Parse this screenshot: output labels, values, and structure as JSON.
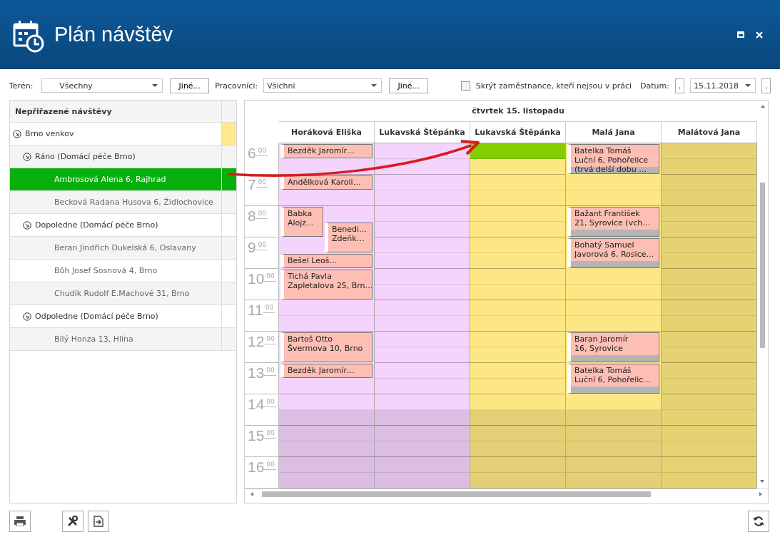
{
  "window": {
    "title": "Plán návštěv"
  },
  "filters": {
    "terrain": {
      "label": "Terén:",
      "value": "Všechny",
      "button": "Jiné..."
    },
    "workers": {
      "label": "Pracovníci:",
      "value": "Všichni",
      "button": "Jiné..."
    },
    "hide_absent": {
      "label": "Skrýt zaměstnance, kteří nejsou v práci",
      "checked": false
    },
    "date": {
      "label": "Datum:",
      "prev": ".",
      "value": "15.11.2018",
      "next": "."
    }
  },
  "unassigned": {
    "title": "Nepřiřazené návštěvy",
    "items": [
      {
        "label": "Brno venkov",
        "expanded": true,
        "selected": false,
        "color": "#ffe98a",
        "children": [
          {
            "label": "Ráno (Domácí péče Brno)",
            "expanded": true,
            "selected": false,
            "children": [
              {
                "label": "Ambrosová Alena 6, Rajhrad",
                "selected": true
              },
              {
                "label": "Becková Radana Husova 6, Židlochovice",
                "selected": false
              }
            ]
          },
          {
            "label": "Dopoledne (Domácí péče Brno)",
            "expanded": true,
            "selected": false,
            "children": [
              {
                "label": "Beran Jindřich Dukelská 6, Oslavany",
                "selected": false
              },
              {
                "label": "Bůh Josef Sosnová 4, Brno",
                "selected": false
              },
              {
                "label": "Chudík Rudolf E.Machové 31, Brno",
                "selected": false
              }
            ]
          },
          {
            "label": "Odpoledne (Domácí péče Brno)",
            "expanded": true,
            "selected": false,
            "children": [
              {
                "label": "Bílý Honza 13, Hlína",
                "selected": false
              }
            ]
          }
        ]
      }
    ]
  },
  "schedule": {
    "day": "čtvrtek 15. listopadu",
    "hours": [
      {
        "hour": "6",
        "minutes": "00"
      },
      {
        "hour": "7",
        "minutes": "00"
      },
      {
        "hour": "8",
        "minutes": "00"
      },
      {
        "hour": "9",
        "minutes": "00"
      },
      {
        "hour": "10",
        "minutes": "00"
      },
      {
        "hour": "11",
        "minutes": "00"
      },
      {
        "hour": "12",
        "minutes": "00"
      },
      {
        "hour": "13",
        "minutes": "00"
      },
      {
        "hour": "14",
        "minutes": "00"
      },
      {
        "hour": "15",
        "minutes": "00"
      },
      {
        "hour": "16",
        "minutes": "00"
      }
    ],
    "columns": [
      {
        "name": "Horáková Eliška",
        "color": "#f4d4fc",
        "slots": [
          {
            "kind": "event",
            "lines": [
              "Bezděk Jaromír…"
            ],
            "spans_hour": false,
            "shaded": false
          },
          {
            "kind": "free",
            "working": true,
            "highlighted": false
          },
          {
            "kind": "event",
            "lines": [
              "Andělková Karoli…"
            ],
            "spans_hour": false,
            "shaded": false
          },
          {
            "kind": "free",
            "working": true,
            "highlighted": false
          },
          {
            "kind": "pair",
            "events": [
              {
                "lines": [
                  "Babka",
                  "Alojz…"
                ],
                "shaded": false
              },
              {
                "lines": [
                  "Benedi…",
                  "Zdeňk…"
                ],
                "shaded": false
              }
            ]
          },
          {
            "kind": "event",
            "lines": [
              "Bešel Leoš…"
            ],
            "spans_hour": false,
            "shaded": false
          },
          {
            "kind": "event",
            "lines": [
              "Tichá Pavla",
              "Zapletalova 25, Brn…"
            ],
            "spans_hour": true,
            "shaded": false
          },
          {
            "kind": "free",
            "working": true,
            "highlighted": false
          },
          {
            "kind": "free",
            "working": true,
            "highlighted": false
          },
          {
            "kind": "event",
            "lines": [
              "Bartoš Otto",
              "Švermova 10, Brno"
            ],
            "spans_hour": true,
            "shaded": false
          },
          {
            "kind": "event",
            "lines": [
              "Bezděk Jaromír…"
            ],
            "spans_hour": false,
            "shaded": false
          },
          {
            "kind": "free",
            "working": true,
            "highlighted": false
          },
          {
            "kind": "free",
            "working": true,
            "highlighted": false
          },
          {
            "kind": "free",
            "working": false,
            "highlighted": false
          },
          {
            "kind": "free",
            "working": false,
            "highlighted": false
          },
          {
            "kind": "free",
            "working": false,
            "highlighted": false
          },
          {
            "kind": "free",
            "working": false,
            "highlighted": false
          },
          {
            "kind": "free",
            "working": false,
            "highlighted": false
          }
        ]
      },
      {
        "name": "Lukavská Štěpánka",
        "color": "#f4d4fc",
        "slots": [
          {
            "kind": "free",
            "working": true,
            "highlighted": false
          },
          {
            "kind": "free",
            "working": true,
            "highlighted": false
          },
          {
            "kind": "free",
            "working": true,
            "highlighted": false
          },
          {
            "kind": "free",
            "working": true,
            "highlighted": false
          },
          {
            "kind": "free",
            "working": true,
            "highlighted": false
          },
          {
            "kind": "free",
            "working": true,
            "highlighted": false
          },
          {
            "kind": "free",
            "working": true,
            "highlighted": false
          },
          {
            "kind": "free",
            "working": true,
            "highlighted": false
          },
          {
            "kind": "free",
            "working": true,
            "highlighted": false
          },
          {
            "kind": "free",
            "working": true,
            "highlighted": false
          },
          {
            "kind": "free",
            "working": true,
            "highlighted": false
          },
          {
            "kind": "free",
            "working": true,
            "highlighted": false
          },
          {
            "kind": "free",
            "working": true,
            "highlighted": false
          },
          {
            "kind": "free",
            "working": true,
            "highlighted": false
          },
          {
            "kind": "free",
            "working": true,
            "highlighted": false
          },
          {
            "kind": "free",
            "working": true,
            "highlighted": false
          },
          {
            "kind": "free",
            "working": true,
            "highlighted": false
          },
          {
            "kind": "free",
            "working": false,
            "highlighted": false
          },
          {
            "kind": "free",
            "working": false,
            "highlighted": false
          },
          {
            "kind": "free",
            "working": false,
            "highlighted": false
          },
          {
            "kind": "free",
            "working": false,
            "highlighted": false
          },
          {
            "kind": "free",
            "working": false,
            "highlighted": false
          }
        ]
      },
      {
        "name": "Lukavská Štěpánka",
        "color": "#fde784",
        "slots": [
          {
            "kind": "free",
            "working": true,
            "highlighted": true
          },
          {
            "kind": "free",
            "working": true,
            "highlighted": false
          },
          {
            "kind": "free",
            "working": true,
            "highlighted": false
          },
          {
            "kind": "free",
            "working": true,
            "highlighted": false
          },
          {
            "kind": "free",
            "working": true,
            "highlighted": false
          },
          {
            "kind": "free",
            "working": true,
            "highlighted": false
          },
          {
            "kind": "free",
            "working": true,
            "highlighted": false
          },
          {
            "kind": "free",
            "working": true,
            "highlighted": false
          },
          {
            "kind": "free",
            "working": true,
            "highlighted": false
          },
          {
            "kind": "free",
            "working": true,
            "highlighted": false
          },
          {
            "kind": "free",
            "working": true,
            "highlighted": false
          },
          {
            "kind": "free",
            "working": true,
            "highlighted": false
          },
          {
            "kind": "free",
            "working": true,
            "highlighted": false
          },
          {
            "kind": "free",
            "working": true,
            "highlighted": false
          },
          {
            "kind": "free",
            "working": true,
            "highlighted": false
          },
          {
            "kind": "free",
            "working": true,
            "highlighted": false
          },
          {
            "kind": "free",
            "working": true,
            "highlighted": false
          },
          {
            "kind": "free",
            "working": false,
            "highlighted": false
          },
          {
            "kind": "free",
            "working": false,
            "highlighted": false
          },
          {
            "kind": "free",
            "working": false,
            "highlighted": false
          },
          {
            "kind": "free",
            "working": false,
            "highlighted": false
          },
          {
            "kind": "free",
            "working": false,
            "highlighted": false
          }
        ]
      },
      {
        "name": "Malá Jana",
        "color": "#fde784",
        "slots": [
          {
            "kind": "event",
            "lines": [
              "Batelka Tomáš",
              "Luční 6, Pohořelice",
              "(trvá delší dobu …"
            ],
            "spans_hour": true,
            "shaded": true
          },
          {
            "kind": "free",
            "working": true,
            "highlighted": false
          },
          {
            "kind": "free",
            "working": true,
            "highlighted": false
          },
          {
            "kind": "event",
            "lines": [
              "Bažant František",
              "21, Syrovice (vch…"
            ],
            "spans_hour": true,
            "shaded": true
          },
          {
            "kind": "event",
            "lines": [
              "Bohatý Samuel",
              "Javorová 6, Rosice…"
            ],
            "spans_hour": true,
            "shaded": true
          },
          {
            "kind": "free",
            "working": true,
            "highlighted": false
          },
          {
            "kind": "free",
            "working": true,
            "highlighted": false
          },
          {
            "kind": "free",
            "working": true,
            "highlighted": false
          },
          {
            "kind": "free",
            "working": true,
            "highlighted": false
          },
          {
            "kind": "event",
            "lines": [
              "Baran Jaromír",
              "16, Syrovice"
            ],
            "spans_hour": true,
            "shaded": true
          },
          {
            "kind": "event",
            "lines": [
              "Batelka Tomáš",
              "Luční 6, Pohořelic…"
            ],
            "spans_hour": true,
            "shaded": true
          },
          {
            "kind": "free",
            "working": true,
            "highlighted": false
          },
          {
            "kind": "free",
            "working": false,
            "highlighted": false
          },
          {
            "kind": "free",
            "working": false,
            "highlighted": false
          },
          {
            "kind": "free",
            "working": false,
            "highlighted": false
          },
          {
            "kind": "free",
            "working": false,
            "highlighted": false
          },
          {
            "kind": "free",
            "working": false,
            "highlighted": false
          }
        ]
      },
      {
        "name": "Malátová Jana",
        "color": "#e5d373",
        "slots": [
          {
            "kind": "free",
            "working": true,
            "highlighted": false
          },
          {
            "kind": "free",
            "working": true,
            "highlighted": false
          },
          {
            "kind": "free",
            "working": true,
            "highlighted": false
          },
          {
            "kind": "free",
            "working": true,
            "highlighted": false
          },
          {
            "kind": "free",
            "working": true,
            "highlighted": false
          },
          {
            "kind": "free",
            "working": true,
            "highlighted": false
          },
          {
            "kind": "free",
            "working": true,
            "highlighted": false
          },
          {
            "kind": "free",
            "working": true,
            "highlighted": false
          },
          {
            "kind": "free",
            "working": true,
            "highlighted": false
          },
          {
            "kind": "free",
            "working": true,
            "highlighted": false
          },
          {
            "kind": "free",
            "working": true,
            "highlighted": false
          },
          {
            "kind": "free",
            "working": true,
            "highlighted": false
          },
          {
            "kind": "free",
            "working": true,
            "highlighted": false
          },
          {
            "kind": "free",
            "working": true,
            "highlighted": false
          },
          {
            "kind": "free",
            "working": true,
            "highlighted": false
          },
          {
            "kind": "free",
            "working": true,
            "highlighted": false
          },
          {
            "kind": "free",
            "working": true,
            "highlighted": false
          },
          {
            "kind": "free",
            "working": true,
            "highlighted": false
          },
          {
            "kind": "free",
            "working": true,
            "highlighted": false
          },
          {
            "kind": "free",
            "working": true,
            "highlighted": false
          },
          {
            "kind": "free",
            "working": true,
            "highlighted": false
          },
          {
            "kind": "free",
            "working": true,
            "highlighted": false
          }
        ]
      }
    ]
  }
}
